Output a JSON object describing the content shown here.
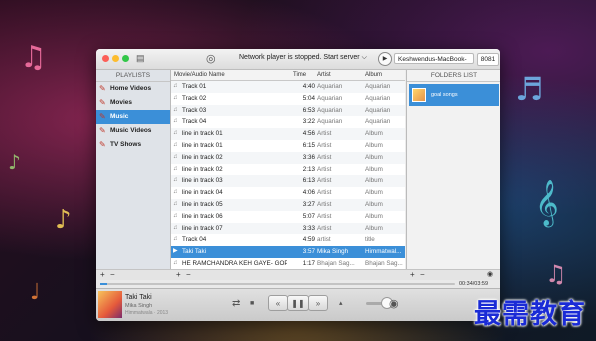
{
  "window": {
    "status_text": "Network player is stopped. Start server",
    "server_dropdown_arrow": "⌵",
    "host_name": "Keshwendus-MacBook-",
    "port": "8081"
  },
  "sidebar": {
    "header": "PLAYLISTS",
    "items": [
      {
        "label": "Home Videos",
        "selected": false
      },
      {
        "label": "Movies",
        "selected": false
      },
      {
        "label": "Music",
        "selected": true
      },
      {
        "label": "Music Videos",
        "selected": false
      },
      {
        "label": "TV Shows",
        "selected": false
      }
    ]
  },
  "table": {
    "columns": {
      "name": "Movie/Audio Name",
      "time": "Time",
      "artist": "Artist",
      "album": "Album"
    },
    "rows": [
      {
        "name": "Track 01",
        "time": "4:40",
        "artist": "Aquarian",
        "album": "Aquarian",
        "selected": false
      },
      {
        "name": "Track 02",
        "time": "5:04",
        "artist": "Aquarian",
        "album": "Aquarian",
        "selected": false
      },
      {
        "name": "Track 03",
        "time": "6:53",
        "artist": "Aquarian",
        "album": "Aquarian",
        "selected": false
      },
      {
        "name": "Track 04",
        "time": "3:22",
        "artist": "Aquarian",
        "album": "Aquarian",
        "selected": false
      },
      {
        "name": "line in track 01",
        "time": "4:56",
        "artist": "Artist",
        "album": "Album",
        "selected": false
      },
      {
        "name": "line in track 01",
        "time": "6:15",
        "artist": "Artist",
        "album": "Album",
        "selected": false
      },
      {
        "name": "line in track 02",
        "time": "3:36",
        "artist": "Artist",
        "album": "Album",
        "selected": false
      },
      {
        "name": "line in track 02",
        "time": "2:13",
        "artist": "Artist",
        "album": "Album",
        "selected": false
      },
      {
        "name": "line in track 03",
        "time": "6:13",
        "artist": "Artist",
        "album": "Album",
        "selected": false
      },
      {
        "name": "line in track 04",
        "time": "4:06",
        "artist": "Artist",
        "album": "Album",
        "selected": false
      },
      {
        "name": "line in track 05",
        "time": "3:27",
        "artist": "Artist",
        "album": "Album",
        "selected": false
      },
      {
        "name": "line in track 06",
        "time": "5:07",
        "artist": "Artist",
        "album": "Album",
        "selected": false
      },
      {
        "name": "line in track 07",
        "time": "3:33",
        "artist": "Artist",
        "album": "Album",
        "selected": false
      },
      {
        "name": "Track 04",
        "time": "4:59",
        "artist": "artist",
        "album": "title",
        "selected": false
      },
      {
        "name": "Taki Taki",
        "time": "3:57",
        "artist": "Mika Singh",
        "album": "Himmatwal...",
        "selected": true
      },
      {
        "name": "HE RAMCHANDRA KEH GAYE- GOP...",
        "time": "1:17",
        "artist": "Bhajan Sag...",
        "album": "Bhajan Sag...",
        "selected": false
      }
    ]
  },
  "folders": {
    "header": "FOLDERS LIST",
    "items": [
      {
        "label": "goal songs"
      }
    ]
  },
  "strip": {
    "add": "+",
    "remove": "−"
  },
  "progress": {
    "elapsed_fraction": 0.02,
    "time": "00:34/03:59"
  },
  "now_playing": {
    "title": "Taki Taki",
    "artist": "Mika Singh",
    "album": "Himmatwala · 2013"
  },
  "controls": {
    "repeat": "⇄",
    "stop": "■",
    "prev": "«",
    "pause": "❚❚",
    "next": "»",
    "airplay": "◉"
  },
  "watermark": "最需教育",
  "colors": {
    "accent": "#3b8fd8",
    "sidebar_bg": "#dfe3e8",
    "close": "#fc5f57",
    "minimize": "#fdbc2e",
    "zoom": "#33c748"
  }
}
